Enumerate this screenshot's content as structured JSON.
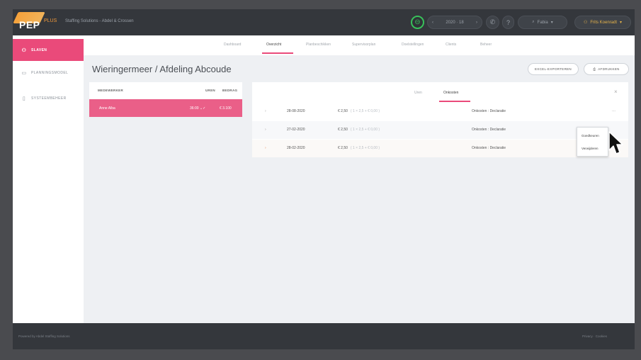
{
  "header": {
    "logo_text": "PEP",
    "logo_plus": "PLUS",
    "breadcrumb": "Staffing Solutions - Abdel & Crossen",
    "timer_icon": "timer-icon",
    "date_prev": "‹",
    "date_label": "2020 · 18",
    "date_next": "›",
    "phone_icon": "phone-icon",
    "help_icon": "help-icon",
    "language": "Fabia",
    "language_icon": "search-icon",
    "user": "Frits Koenradt"
  },
  "sidebar": {
    "items": [
      {
        "label": "Slaven",
        "icon": "users-icon"
      },
      {
        "label": "Planningsmodel",
        "icon": "calendar-icon"
      },
      {
        "label": "Systeembeheer",
        "icon": "document-icon"
      }
    ]
  },
  "tabs": [
    {
      "label": "Dashboard"
    },
    {
      "label": "Overzicht"
    },
    {
      "label": "Planbeschikken"
    },
    {
      "label": "Supervisorplan"
    },
    {
      "label": "Doelstellingen"
    },
    {
      "label": "Clients"
    },
    {
      "label": "Beheer"
    }
  ],
  "page": {
    "title": "Wieringermeer / Afdeling Abcoude",
    "excel_button": "EXCEL-EXPORTEREN",
    "print_button": "AFDRUKKEN"
  },
  "employees": {
    "headers": {
      "name": "MEDEWERKER",
      "hours": "UREN",
      "amount": "BEDRAG"
    },
    "rows": [
      {
        "name": "Anne Alba",
        "hours": "36:00 ⌄✓",
        "amount": "€ 3.100"
      }
    ]
  },
  "detail": {
    "subtabs": [
      {
        "label": "Uren"
      },
      {
        "label": "Onkosten"
      }
    ],
    "close_icon": "close-icon",
    "rows": [
      {
        "chev": "›",
        "date": "28-08-2020",
        "amount": "€ 2,50",
        "calc": "( 1 × 2,5 + € 0,00 )",
        "type": "Onkosten : Declaratie",
        "more": "⋯"
      },
      {
        "chev": "›",
        "date": "27-02-2020",
        "amount": "€ 2,50",
        "calc": "( 1 × 2,5 + € 0,00 )",
        "type": "Onkosten : Declaratie",
        "more": ""
      },
      {
        "chev": "›",
        "date": "28-02-2020",
        "amount": "€ 2,50",
        "calc": "( 1 × 2,5 + € 0,00 )",
        "type": "Onkosten : Declaratie",
        "more": ""
      }
    ]
  },
  "row_menu": {
    "items": [
      {
        "label": "Goedkeuren"
      },
      {
        "label": "Verwijderen"
      }
    ]
  },
  "footer": {
    "left": "Powered by Abdel Staffing Solutions",
    "right": "Privacy · Cookies"
  },
  "colors": {
    "accent": "#ea4a7a",
    "topbar": "#34373c",
    "timer": "#38c15a",
    "user": "#e6b34a"
  }
}
